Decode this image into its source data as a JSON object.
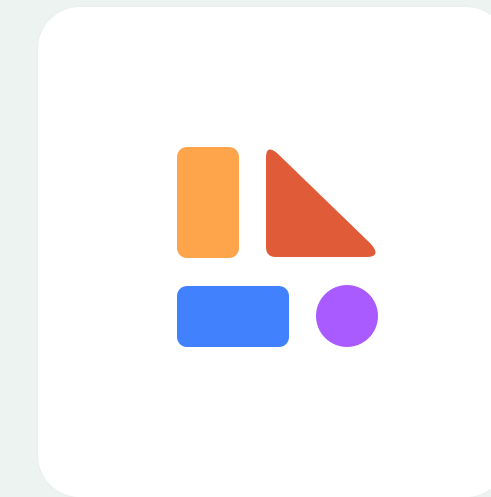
{
  "colors": {
    "background": "#ecf3f0",
    "card": "#ffffff",
    "orange_rect": "#fea54b",
    "red_triangle": "#e05c38",
    "blue_rect": "#4181fd",
    "purple_circle": "#a95bff"
  },
  "icon": {
    "name": "app-logo-icon"
  }
}
